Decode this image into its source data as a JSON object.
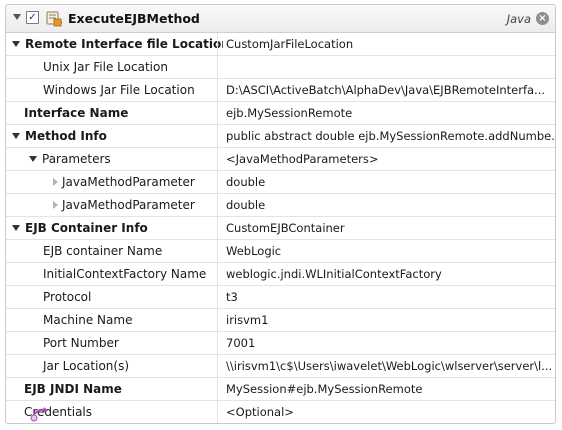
{
  "header": {
    "title": "ExecuteEJBMethod",
    "language": "Java",
    "close_glyph": "×",
    "checkbox_glyph": "✓",
    "icon": "method-puzzle-icon",
    "close_icon": "close-circle-icon"
  },
  "rows": [
    {
      "label": "Remote Interface file Location",
      "value": "CustomJarFileLocation"
    },
    {
      "label": "Unix Jar File Location",
      "value": ""
    },
    {
      "label": "Windows Jar File Location",
      "value": "D:\\ASCI\\ActiveBatch\\AlphaDev\\Java\\EJBRemoteInterfa..."
    },
    {
      "label": "Interface Name",
      "value": "ejb.MySessionRemote"
    },
    {
      "label": "Method Info",
      "value": "public abstract double ejb.MySessionRemote.addNumbe..."
    },
    {
      "label": "Parameters",
      "value": "<JavaMethodParameters>"
    },
    {
      "label": "JavaMethodParameter",
      "value": "double"
    },
    {
      "label": "JavaMethodParameter",
      "value": "double"
    },
    {
      "label": "EJB Container Info",
      "value": "CustomEJBContainer"
    },
    {
      "label": "EJB container Name",
      "value": "WebLogic"
    },
    {
      "label": "InitialContextFactory Name",
      "value": "weblogic.jndi.WLInitialContextFactory"
    },
    {
      "label": "Protocol",
      "value": "t3"
    },
    {
      "label": "Machine Name",
      "value": "irisvm1"
    },
    {
      "label": "Port Number",
      "value": "7001"
    },
    {
      "label": "Jar Location(s)",
      "value": "\\\\irisvm1\\c$\\Users\\iwavelet\\WebLogic\\wlserver\\server\\l..."
    },
    {
      "label": "EJB JNDI Name",
      "value": "MySession#ejb.MySessionRemote"
    },
    {
      "label": "Credentials",
      "value": "<Optional>"
    }
  ],
  "footer": {
    "icon": "add-step-icon"
  },
  "colors": {
    "header_bg": "#ececec",
    "border": "#c9c9c9",
    "grid_line": "#e3e3e3",
    "icon_accent": "#d08a1a"
  }
}
